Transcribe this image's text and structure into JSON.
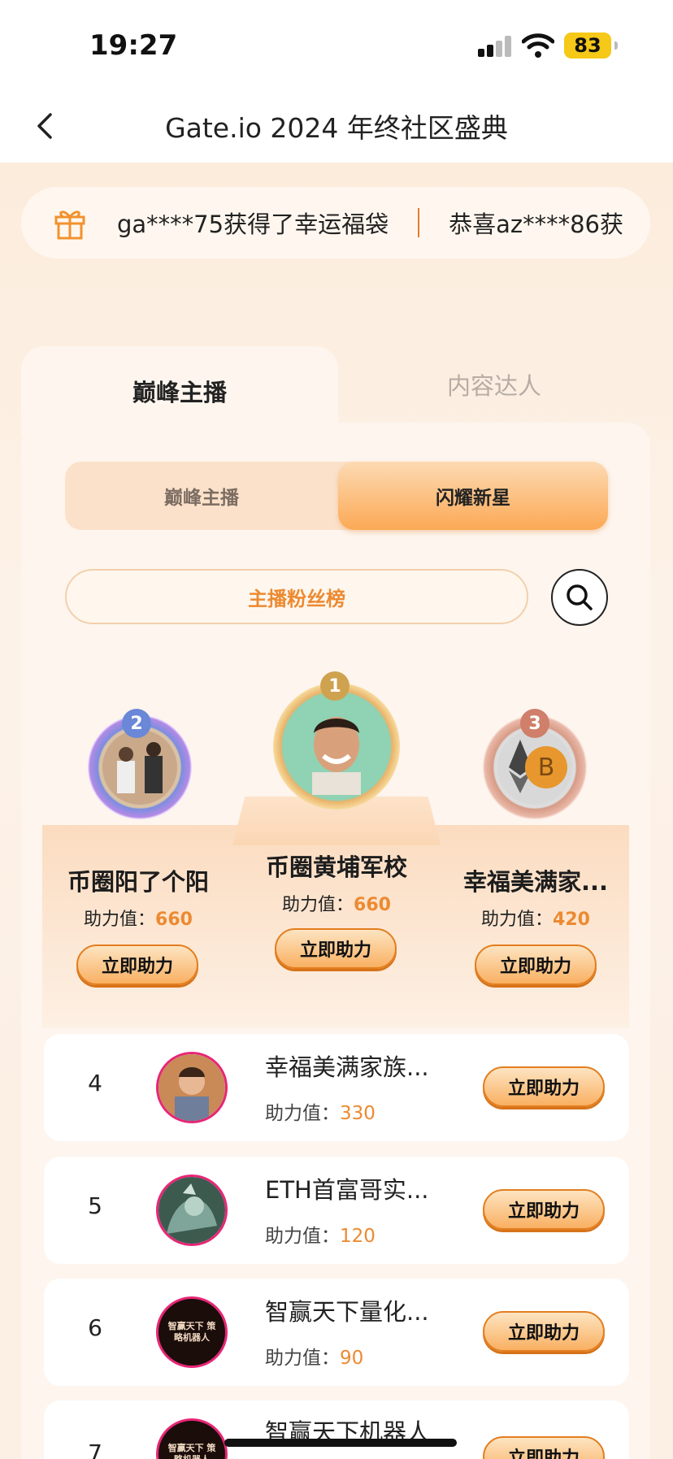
{
  "status": {
    "time": "19:27",
    "battery": "83"
  },
  "nav": {
    "title": "Gate.io 2024 年终社区盛典"
  },
  "ticker": {
    "items": [
      "ga****75获得了幸运福袋",
      "恭喜az****86获"
    ]
  },
  "tabs": {
    "active": "巅峰主播",
    "inactive": "内容达人"
  },
  "segment": {
    "left": "巅峰主播",
    "right": "闪耀新星"
  },
  "fans_button": "主播粉丝榜",
  "score_label": "助力值：",
  "boost_label": "立即助力",
  "podium": [
    {
      "rank": "1",
      "name": "币圈黄埔军校",
      "score": "660"
    },
    {
      "rank": "2",
      "name": "币圈阳了个阳",
      "score": "660"
    },
    {
      "rank": "3",
      "name": "幸福美满家...",
      "score": "420"
    }
  ],
  "list": [
    {
      "rank": "4",
      "name": "幸福美满家族...",
      "score": "330",
      "avatar_text": ""
    },
    {
      "rank": "5",
      "name": "ETH首富哥实...",
      "score": "120",
      "avatar_text": ""
    },
    {
      "rank": "6",
      "name": "智赢天下量化...",
      "score": "90",
      "avatar_text": "智赢天下 策略机器人"
    },
    {
      "rank": "7",
      "name": "智赢天下机器人",
      "score": "",
      "avatar_text": "智赢天下 策略机器人"
    }
  ],
  "colors": {
    "accent": "#ec8a31",
    "button_border": "#e27e1f",
    "panel": "#fdf5ee"
  }
}
